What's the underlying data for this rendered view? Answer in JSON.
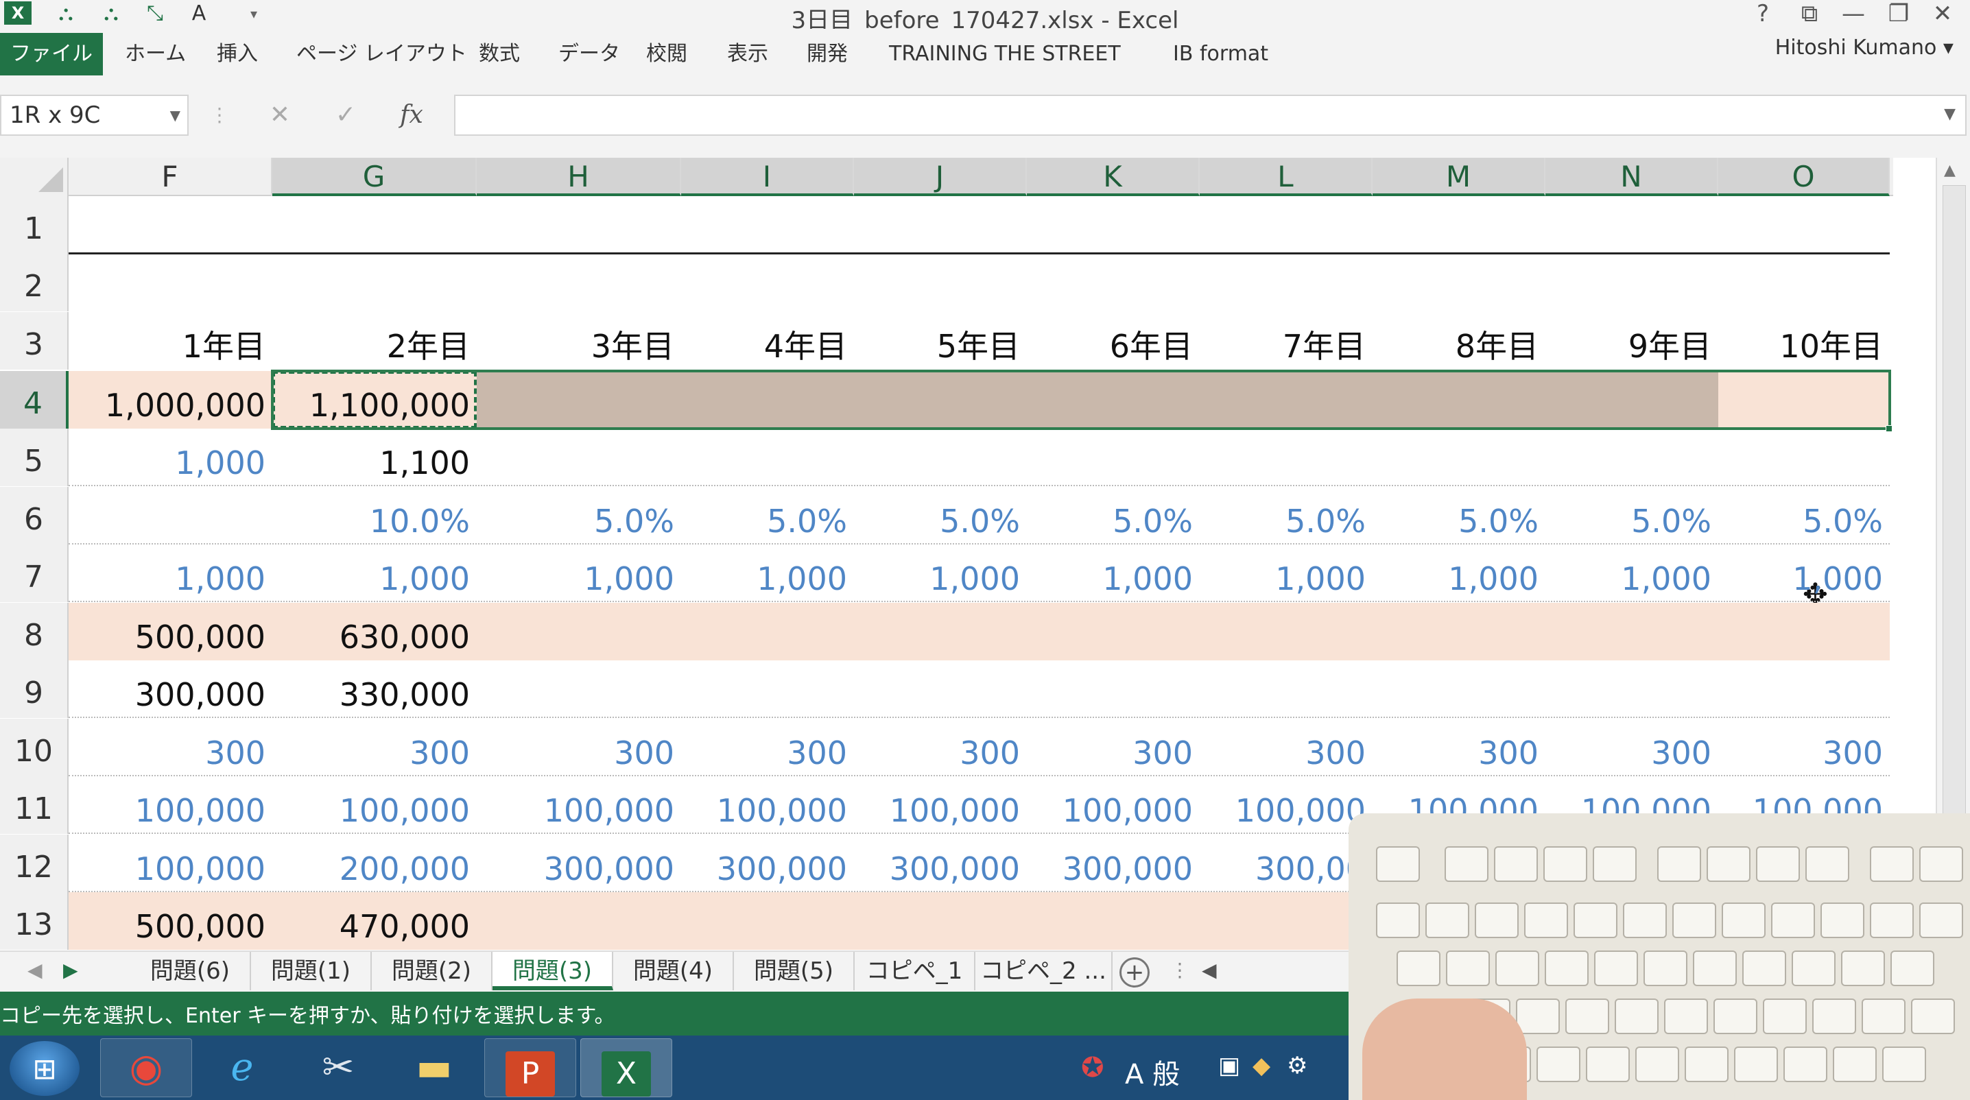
{
  "window": {
    "title": "3日目_before_170427.xlsx - Excel",
    "help": "?",
    "controls": [
      "⧉",
      "—",
      "❐",
      "✕"
    ]
  },
  "ribbon": {
    "file_tab": "ファイル",
    "tabs": [
      "ホーム",
      "挿入",
      "ページ レイアウト",
      "数式",
      "データ",
      "校閲",
      "表示",
      "開発",
      "TRAINING THE STREET",
      "IB format"
    ],
    "user": "Hitoshi Kumano ▾"
  },
  "formula_bar": {
    "name_box": "1R x 9C",
    "cancel": "✕",
    "enter": "✓",
    "fx": "fx",
    "value": ""
  },
  "grid": {
    "columns": [
      "F",
      "G",
      "H",
      "I",
      "J",
      "K",
      "L",
      "M",
      "N",
      "O"
    ],
    "rows": [
      {
        "num": "1",
        "cells": [
          "",
          "",
          "",
          "",
          "",
          "",
          "",
          "",
          "",
          ""
        ]
      },
      {
        "num": "2",
        "cells": [
          "",
          "",
          "",
          "",
          "",
          "",
          "",
          "",
          "",
          ""
        ]
      },
      {
        "num": "3",
        "cells": [
          "1年目",
          "2年目",
          "3年目",
          "4年目",
          "5年目",
          "6年目",
          "7年目",
          "8年目",
          "9年目",
          "10年目"
        ]
      },
      {
        "num": "4",
        "cells": [
          "1,000,000",
          "1,100,000",
          "",
          "",
          "",
          "",
          "",
          "",
          "",
          ""
        ]
      },
      {
        "num": "5",
        "cells": [
          "1,000",
          "1,100",
          "",
          "",
          "",
          "",
          "",
          "",
          "",
          ""
        ]
      },
      {
        "num": "6",
        "cells": [
          "",
          "10.0%",
          "5.0%",
          "5.0%",
          "5.0%",
          "5.0%",
          "5.0%",
          "5.0%",
          "5.0%",
          "5.0%"
        ]
      },
      {
        "num": "7",
        "cells": [
          "1,000",
          "1,000",
          "1,000",
          "1,000",
          "1,000",
          "1,000",
          "1,000",
          "1,000",
          "1,000",
          "1,000"
        ]
      },
      {
        "num": "8",
        "cells": [
          "500,000",
          "630,000",
          "",
          "",
          "",
          "",
          "",
          "",
          "",
          ""
        ]
      },
      {
        "num": "9",
        "cells": [
          "300,000",
          "330,000",
          "",
          "",
          "",
          "",
          "",
          "",
          "",
          ""
        ]
      },
      {
        "num": "10",
        "cells": [
          "300",
          "300",
          "300",
          "300",
          "300",
          "300",
          "300",
          "300",
          "300",
          "300"
        ]
      },
      {
        "num": "11",
        "cells": [
          "100,000",
          "100,000",
          "100,000",
          "100,000",
          "100,000",
          "100,000",
          "100,000",
          "100,000",
          "100,000",
          "100,000"
        ]
      },
      {
        "num": "12",
        "cells": [
          "100,000",
          "200,000",
          "300,000",
          "300,000",
          "300,000",
          "300,000",
          "300,00",
          "",
          "",
          ""
        ]
      },
      {
        "num": "13",
        "cells": [
          "500,000",
          "470,000",
          "",
          "",
          "",
          "",
          "",
          "",
          "",
          ""
        ]
      }
    ]
  },
  "sheets": {
    "tabs": [
      "問題(6)",
      "問題(1)",
      "問題(2)",
      "問題(3)",
      "問題(4)",
      "問題(5)",
      "コピペ_1",
      "コピペ_2 ..."
    ],
    "active_index": 3
  },
  "status": {
    "message": "コピー先を選択し、Enter キーを押すか、貼り付けを選択します。"
  },
  "taskbar": {
    "tray_text": "A 般"
  },
  "colors": {
    "excel_green": "#217346",
    "input_blue": "#4f86c6",
    "highlight_row": "#f9e3d6",
    "paste_preview": "#c9b8ab",
    "taskbar": "#1d4c77"
  }
}
